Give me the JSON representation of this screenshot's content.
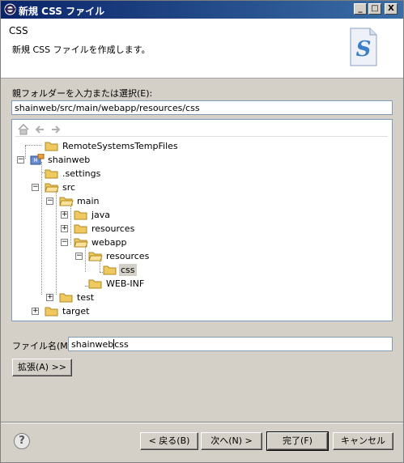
{
  "window": {
    "title": "新規 CSS ファイル",
    "controls": [
      "_",
      "□",
      "X"
    ]
  },
  "banner": {
    "title": "CSS",
    "description": "新規 CSS ファイルを作成します。",
    "icon": "css-s-icon"
  },
  "parent_folder": {
    "label": "親フォルダーを入力または選択(E):",
    "value": "shainweb/src/main/webapp/resources/css"
  },
  "tree": {
    "toolbar": [
      "home-icon",
      "back-arrow-icon",
      "forward-arrow-icon"
    ],
    "nodes": [
      {
        "label": "RemoteSystemsTempFiles",
        "icon": "folder-icon",
        "expander": ""
      },
      {
        "label": "shainweb",
        "icon": "project-icon",
        "expander": "−"
      },
      {
        "label": ".settings",
        "icon": "folder-icon",
        "expander": ""
      },
      {
        "label": "src",
        "icon": "folder-open-icon",
        "expander": "−"
      },
      {
        "label": "main",
        "icon": "folder-open-icon",
        "expander": "−"
      },
      {
        "label": "java",
        "icon": "folder-icon",
        "expander": "+"
      },
      {
        "label": "resources",
        "icon": "folder-icon",
        "expander": "+"
      },
      {
        "label": "webapp",
        "icon": "folder-open-icon",
        "expander": "−"
      },
      {
        "label": "resources",
        "icon": "folder-open-icon",
        "expander": "−"
      },
      {
        "label": "css",
        "icon": "folder-icon",
        "expander": "",
        "selected": true
      },
      {
        "label": "WEB-INF",
        "icon": "folder-icon",
        "expander": ""
      },
      {
        "label": "test",
        "icon": "folder-icon",
        "expander": "+"
      },
      {
        "label": "target",
        "icon": "folder-icon",
        "expander": "+"
      }
    ]
  },
  "file_name": {
    "label": "ファイル名(M):",
    "value_before_caret": "shainweb",
    "value_after_caret": "css"
  },
  "advanced_button": "拡張(A) >>",
  "footer": {
    "help": "?",
    "back": "< 戻る(B)",
    "next": "次へ(N) >",
    "finish": "完了(F)",
    "cancel": "キャンセル"
  },
  "colors": {
    "titlebar": "#0a246a",
    "dialog": "#d4d0c8",
    "folder": "#f0c860"
  }
}
